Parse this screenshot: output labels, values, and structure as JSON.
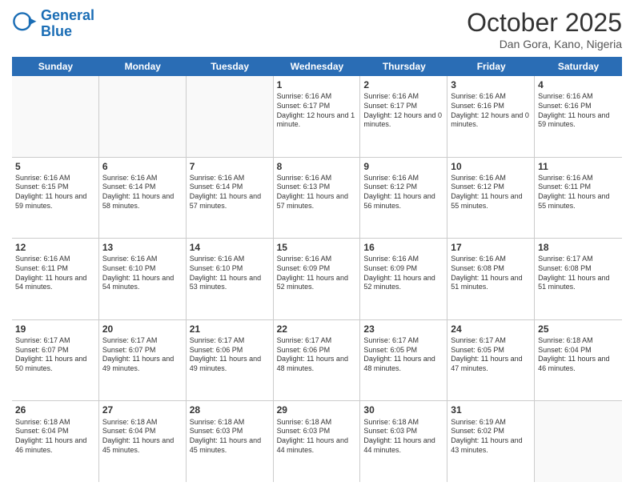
{
  "header": {
    "logo_general": "General",
    "logo_blue": "Blue",
    "month_title": "October 2025",
    "location": "Dan Gora, Kano, Nigeria"
  },
  "days_of_week": [
    "Sunday",
    "Monday",
    "Tuesday",
    "Wednesday",
    "Thursday",
    "Friday",
    "Saturday"
  ],
  "weeks": [
    [
      {
        "day": "",
        "sunrise": "",
        "sunset": "",
        "daylight": "",
        "empty": true
      },
      {
        "day": "",
        "sunrise": "",
        "sunset": "",
        "daylight": "",
        "empty": true
      },
      {
        "day": "",
        "sunrise": "",
        "sunset": "",
        "daylight": "",
        "empty": true
      },
      {
        "day": "1",
        "sunrise": "Sunrise: 6:16 AM",
        "sunset": "Sunset: 6:17 PM",
        "daylight": "Daylight: 12 hours and 1 minute."
      },
      {
        "day": "2",
        "sunrise": "Sunrise: 6:16 AM",
        "sunset": "Sunset: 6:17 PM",
        "daylight": "Daylight: 12 hours and 0 minutes."
      },
      {
        "day": "3",
        "sunrise": "Sunrise: 6:16 AM",
        "sunset": "Sunset: 6:16 PM",
        "daylight": "Daylight: 12 hours and 0 minutes."
      },
      {
        "day": "4",
        "sunrise": "Sunrise: 6:16 AM",
        "sunset": "Sunset: 6:16 PM",
        "daylight": "Daylight: 11 hours and 59 minutes."
      }
    ],
    [
      {
        "day": "5",
        "sunrise": "Sunrise: 6:16 AM",
        "sunset": "Sunset: 6:15 PM",
        "daylight": "Daylight: 11 hours and 59 minutes."
      },
      {
        "day": "6",
        "sunrise": "Sunrise: 6:16 AM",
        "sunset": "Sunset: 6:14 PM",
        "daylight": "Daylight: 11 hours and 58 minutes."
      },
      {
        "day": "7",
        "sunrise": "Sunrise: 6:16 AM",
        "sunset": "Sunset: 6:14 PM",
        "daylight": "Daylight: 11 hours and 57 minutes."
      },
      {
        "day": "8",
        "sunrise": "Sunrise: 6:16 AM",
        "sunset": "Sunset: 6:13 PM",
        "daylight": "Daylight: 11 hours and 57 minutes."
      },
      {
        "day": "9",
        "sunrise": "Sunrise: 6:16 AM",
        "sunset": "Sunset: 6:12 PM",
        "daylight": "Daylight: 11 hours and 56 minutes."
      },
      {
        "day": "10",
        "sunrise": "Sunrise: 6:16 AM",
        "sunset": "Sunset: 6:12 PM",
        "daylight": "Daylight: 11 hours and 55 minutes."
      },
      {
        "day": "11",
        "sunrise": "Sunrise: 6:16 AM",
        "sunset": "Sunset: 6:11 PM",
        "daylight": "Daylight: 11 hours and 55 minutes."
      }
    ],
    [
      {
        "day": "12",
        "sunrise": "Sunrise: 6:16 AM",
        "sunset": "Sunset: 6:11 PM",
        "daylight": "Daylight: 11 hours and 54 minutes."
      },
      {
        "day": "13",
        "sunrise": "Sunrise: 6:16 AM",
        "sunset": "Sunset: 6:10 PM",
        "daylight": "Daylight: 11 hours and 54 minutes."
      },
      {
        "day": "14",
        "sunrise": "Sunrise: 6:16 AM",
        "sunset": "Sunset: 6:10 PM",
        "daylight": "Daylight: 11 hours and 53 minutes."
      },
      {
        "day": "15",
        "sunrise": "Sunrise: 6:16 AM",
        "sunset": "Sunset: 6:09 PM",
        "daylight": "Daylight: 11 hours and 52 minutes."
      },
      {
        "day": "16",
        "sunrise": "Sunrise: 6:16 AM",
        "sunset": "Sunset: 6:09 PM",
        "daylight": "Daylight: 11 hours and 52 minutes."
      },
      {
        "day": "17",
        "sunrise": "Sunrise: 6:16 AM",
        "sunset": "Sunset: 6:08 PM",
        "daylight": "Daylight: 11 hours and 51 minutes."
      },
      {
        "day": "18",
        "sunrise": "Sunrise: 6:17 AM",
        "sunset": "Sunset: 6:08 PM",
        "daylight": "Daylight: 11 hours and 51 minutes."
      }
    ],
    [
      {
        "day": "19",
        "sunrise": "Sunrise: 6:17 AM",
        "sunset": "Sunset: 6:07 PM",
        "daylight": "Daylight: 11 hours and 50 minutes."
      },
      {
        "day": "20",
        "sunrise": "Sunrise: 6:17 AM",
        "sunset": "Sunset: 6:07 PM",
        "daylight": "Daylight: 11 hours and 49 minutes."
      },
      {
        "day": "21",
        "sunrise": "Sunrise: 6:17 AM",
        "sunset": "Sunset: 6:06 PM",
        "daylight": "Daylight: 11 hours and 49 minutes."
      },
      {
        "day": "22",
        "sunrise": "Sunrise: 6:17 AM",
        "sunset": "Sunset: 6:06 PM",
        "daylight": "Daylight: 11 hours and 48 minutes."
      },
      {
        "day": "23",
        "sunrise": "Sunrise: 6:17 AM",
        "sunset": "Sunset: 6:05 PM",
        "daylight": "Daylight: 11 hours and 48 minutes."
      },
      {
        "day": "24",
        "sunrise": "Sunrise: 6:17 AM",
        "sunset": "Sunset: 6:05 PM",
        "daylight": "Daylight: 11 hours and 47 minutes."
      },
      {
        "day": "25",
        "sunrise": "Sunrise: 6:18 AM",
        "sunset": "Sunset: 6:04 PM",
        "daylight": "Daylight: 11 hours and 46 minutes."
      }
    ],
    [
      {
        "day": "26",
        "sunrise": "Sunrise: 6:18 AM",
        "sunset": "Sunset: 6:04 PM",
        "daylight": "Daylight: 11 hours and 46 minutes."
      },
      {
        "day": "27",
        "sunrise": "Sunrise: 6:18 AM",
        "sunset": "Sunset: 6:04 PM",
        "daylight": "Daylight: 11 hours and 45 minutes."
      },
      {
        "day": "28",
        "sunrise": "Sunrise: 6:18 AM",
        "sunset": "Sunset: 6:03 PM",
        "daylight": "Daylight: 11 hours and 45 minutes."
      },
      {
        "day": "29",
        "sunrise": "Sunrise: 6:18 AM",
        "sunset": "Sunset: 6:03 PM",
        "daylight": "Daylight: 11 hours and 44 minutes."
      },
      {
        "day": "30",
        "sunrise": "Sunrise: 6:18 AM",
        "sunset": "Sunset: 6:03 PM",
        "daylight": "Daylight: 11 hours and 44 minutes."
      },
      {
        "day": "31",
        "sunrise": "Sunrise: 6:19 AM",
        "sunset": "Sunset: 6:02 PM",
        "daylight": "Daylight: 11 hours and 43 minutes."
      },
      {
        "day": "",
        "sunrise": "",
        "sunset": "",
        "daylight": "",
        "empty": true
      }
    ]
  ]
}
